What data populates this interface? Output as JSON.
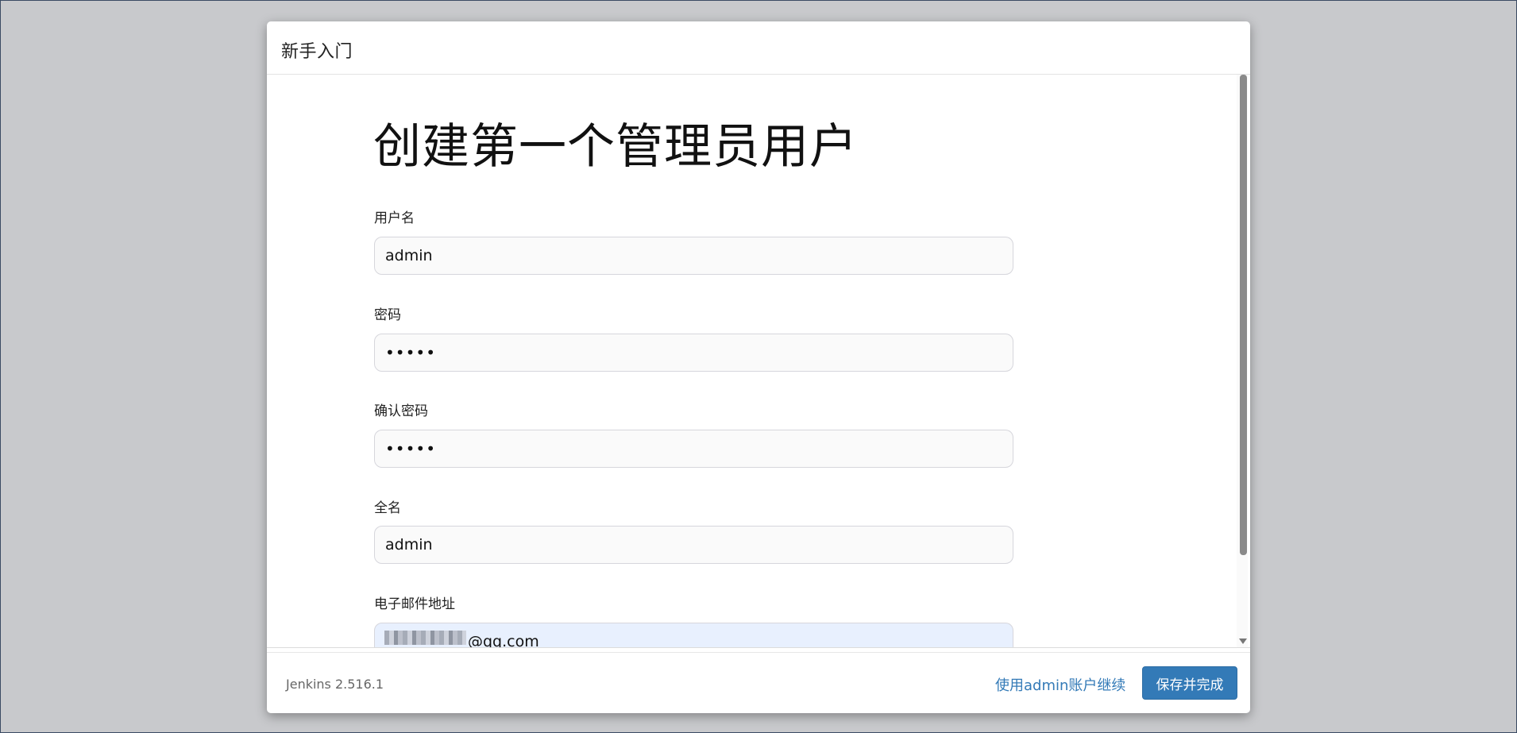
{
  "dialog": {
    "title": "新手入门",
    "heading": "创建第一个管理员用户"
  },
  "form": {
    "username": {
      "label": "用户名",
      "value": "admin"
    },
    "password": {
      "label": "密码",
      "value": "•••••"
    },
    "confirm_password": {
      "label": "确认密码",
      "value": "•••••"
    },
    "full_name": {
      "label": "全名",
      "value": "admin"
    },
    "email": {
      "label": "电子邮件地址",
      "value": "@qq.com"
    }
  },
  "footer": {
    "version": "Jenkins 2.516.1",
    "continue_link": "使用admin账户继续",
    "save_button": "保存并完成"
  },
  "colors": {
    "primary": "#337ab7",
    "overlay": "#c8c9cc",
    "email_autofill": "#e8f0fe"
  }
}
